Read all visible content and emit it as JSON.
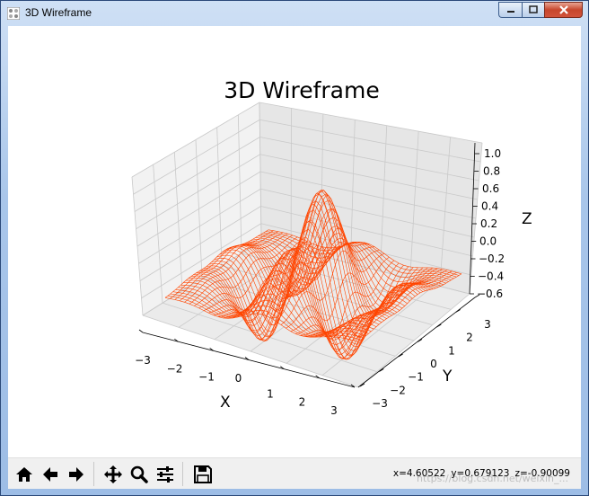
{
  "window": {
    "title": "3D Wireframe"
  },
  "figure": {
    "title": "3D Wireframe",
    "wire_color": "#ff4500"
  },
  "chart_data": {
    "type": "wireframe",
    "title": "3D Wireframe",
    "xlabel": "X",
    "ylabel": "Y",
    "zlabel": "Z",
    "xlim": [
      -3,
      3
    ],
    "ylim": [
      -3,
      3
    ],
    "zlim": [
      -0.7,
      1.1
    ],
    "x_ticks": [
      "−3",
      "−2",
      "−1",
      "0",
      "1",
      "2",
      "3"
    ],
    "y_ticks": [
      "−3",
      "−2",
      "−1",
      "0",
      "1",
      "2",
      "3"
    ],
    "z_ticks": [
      "1.0",
      "0.8",
      "0.6",
      "0.4",
      "0.2",
      "0.0",
      "−0.2",
      "−0.4",
      "−0.6"
    ],
    "surface_peak_z": 1.0,
    "surface_min_z": -0.6,
    "grid": true
  },
  "toolbar": {
    "home": "home-icon",
    "back": "back-arrow-icon",
    "forward": "forward-arrow-icon",
    "pan": "pan-icon",
    "zoom": "zoom-icon",
    "configure": "configure-subplots-icon",
    "save": "save-icon"
  },
  "status": {
    "x": "x=4.60522",
    "y": "y=0.679123",
    "z": "z=-0.90099"
  },
  "watermark": "https://blog.csdn.net/weixin_..."
}
